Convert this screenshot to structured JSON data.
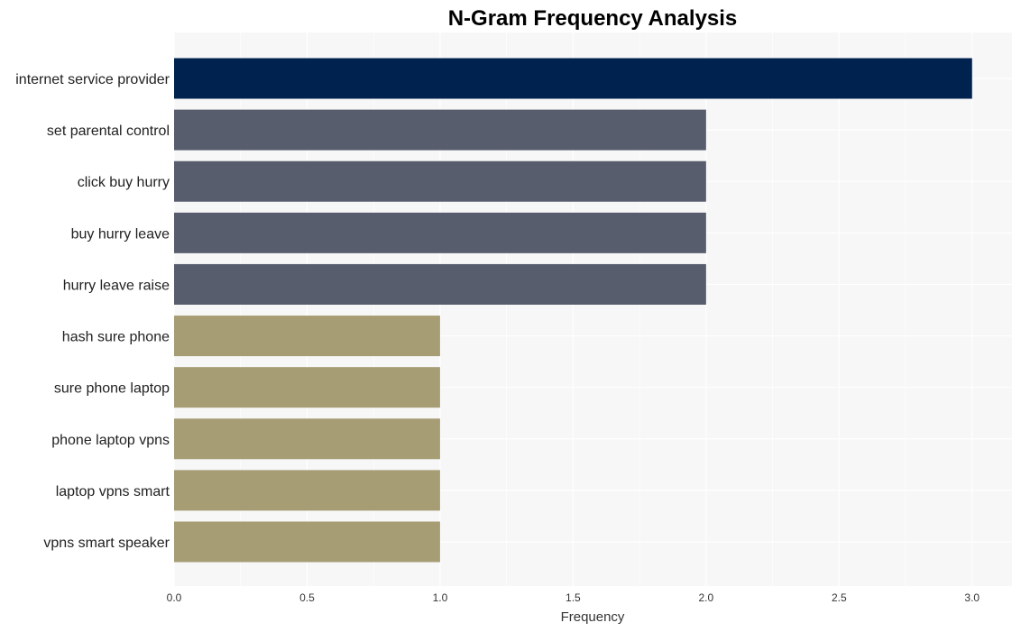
{
  "chart_data": {
    "type": "bar",
    "orientation": "horizontal",
    "title": "N-Gram Frequency Analysis",
    "xlabel": "Frequency",
    "ylabel": "",
    "xlim": [
      0,
      3.15
    ],
    "xticks": [
      0.0,
      0.5,
      1.0,
      1.5,
      2.0,
      2.5,
      3.0
    ],
    "xtick_labels": [
      "0.0",
      "0.5",
      "1.0",
      "1.5",
      "2.0",
      "2.5",
      "3.0"
    ],
    "grid": true,
    "legend": "none",
    "categories": [
      "internet service provider",
      "set parental control",
      "click buy hurry",
      "buy hurry leave",
      "hurry leave raise",
      "hash sure phone",
      "sure phone laptop",
      "phone laptop vpns",
      "laptop vpns smart",
      "vpns smart speaker"
    ],
    "values": [
      3,
      2,
      2,
      2,
      2,
      1,
      1,
      1,
      1,
      1
    ],
    "colors": {
      "3": "#00224e",
      "2": "#575d6d",
      "1": "#a69d75"
    },
    "background": "#f7f7f7",
    "gridline_color": "#ffffff"
  }
}
